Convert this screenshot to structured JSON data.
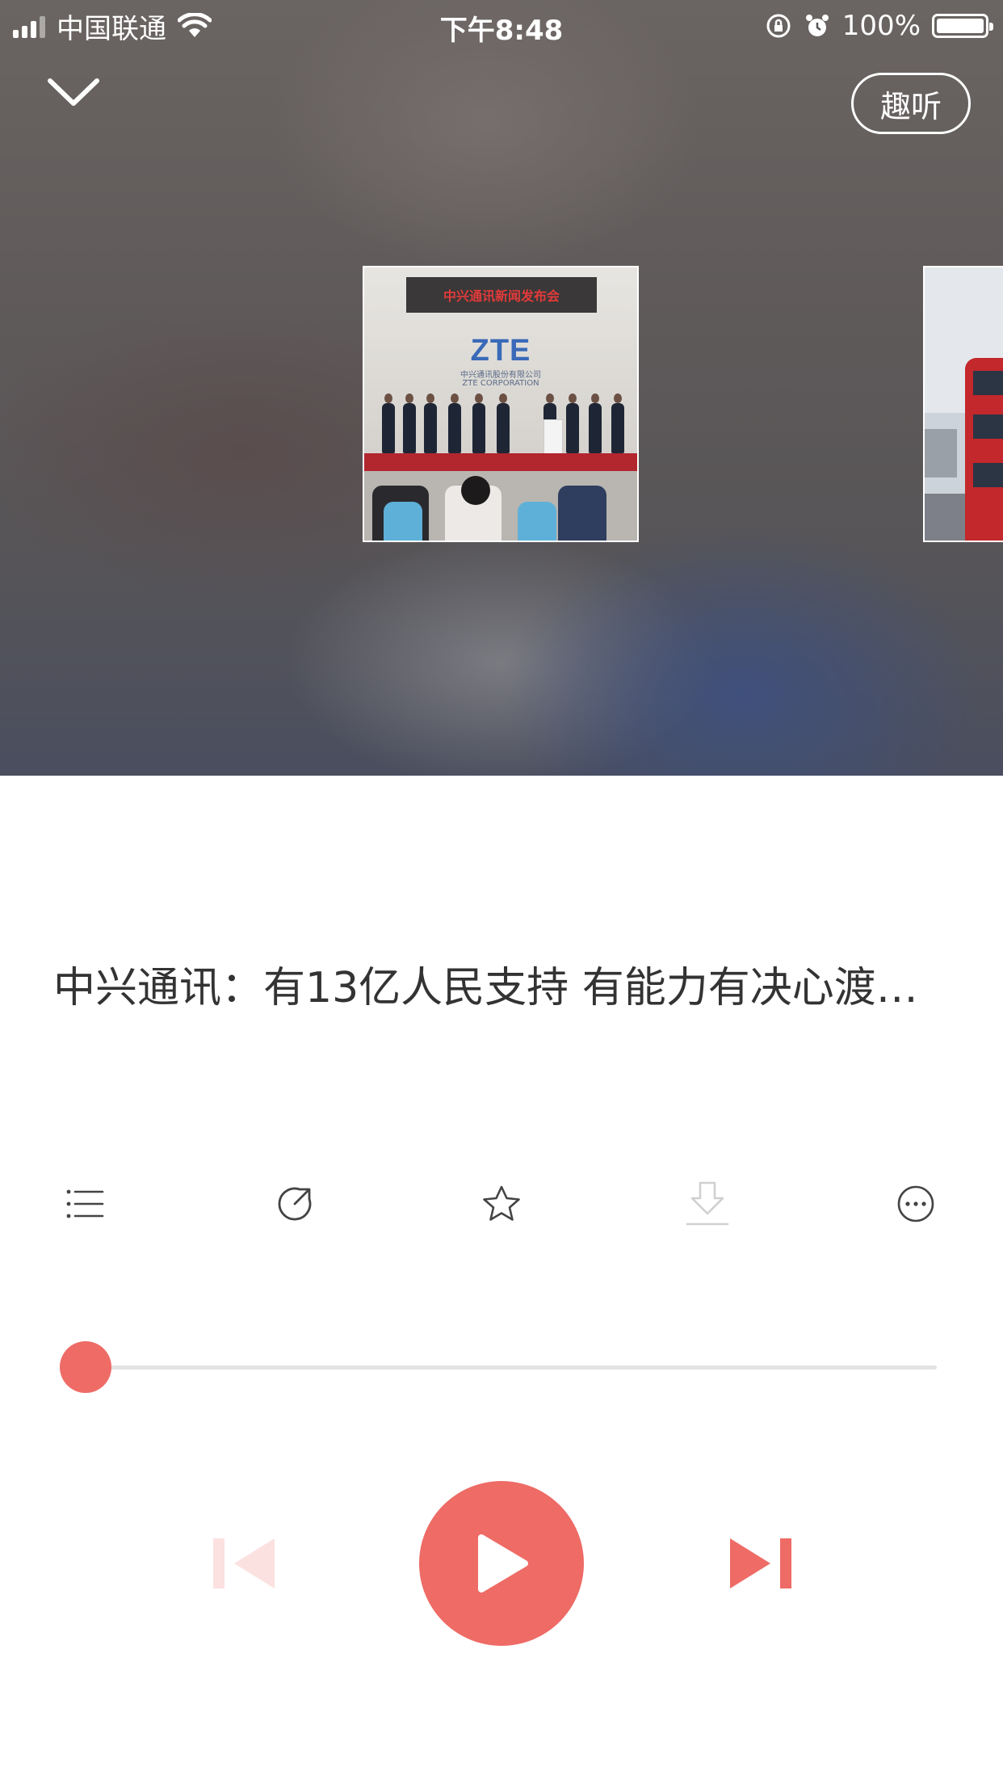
{
  "status_bar": {
    "carrier": "中国联通",
    "time": "下午8:48",
    "battery": "100%"
  },
  "header": {
    "collapse_icon": "chevron-down-icon",
    "qu_ting_label": "趣听"
  },
  "carousel": {
    "current_image": {
      "banner_text": "中兴通讯新闻发布会",
      "logo_text": "ZTE",
      "sub_cn": "中兴通讯股份有限公司",
      "sub_en": "ZTE CORPORATION"
    }
  },
  "track": {
    "title": "中兴通讯：有13亿人民支持 有能力有决心渡…"
  },
  "toolbar": {
    "items": [
      {
        "icon": "playlist-icon",
        "enabled": true
      },
      {
        "icon": "share-icon",
        "enabled": true
      },
      {
        "icon": "star-icon",
        "enabled": true
      },
      {
        "icon": "download-icon",
        "enabled": false
      },
      {
        "icon": "more-icon",
        "enabled": true
      }
    ]
  },
  "playback": {
    "progress": 0.0,
    "state": "paused",
    "prev_enabled": false,
    "next_enabled": true
  },
  "colors": {
    "accent": "#ee6b66",
    "accent_disabled": "#fbe1e0",
    "title_text": "#333333",
    "icon": "#444444",
    "icon_disabled": "#d0d0d0"
  }
}
